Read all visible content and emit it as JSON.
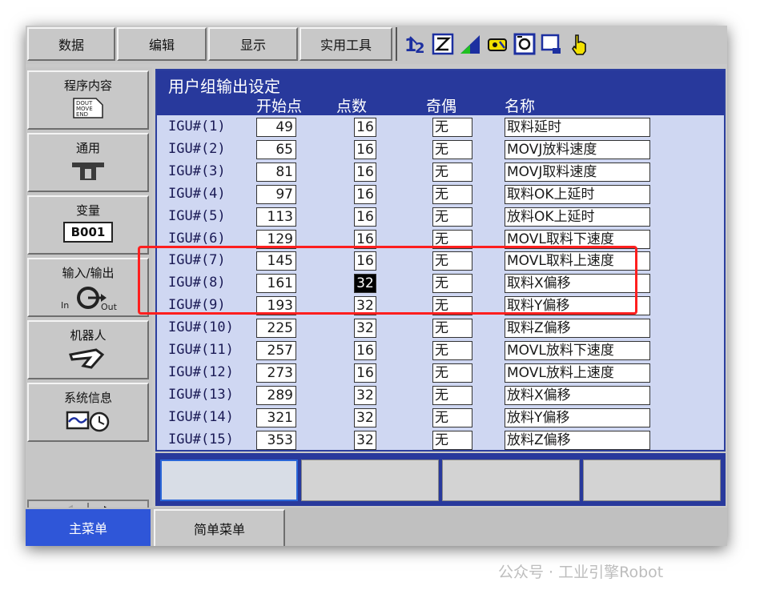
{
  "menu": [
    "数据",
    "编辑",
    "显示",
    "实用工具"
  ],
  "sidebar": [
    {
      "label": "程序内容",
      "icon": "program-content-icon",
      "icon_text": [
        "DOUT",
        "MOVE",
        "END"
      ]
    },
    {
      "label": "通用",
      "icon": "general-tool-icon"
    },
    {
      "label": "变量",
      "icon": "variable-icon",
      "badge": "B001"
    },
    {
      "label": "输入/输出",
      "icon": "io-icon",
      "sub_left": "In",
      "sub_right": "Out"
    },
    {
      "label": "机器人",
      "icon": "robot-arm-icon"
    },
    {
      "label": "系统信息",
      "icon": "system-info-icon"
    }
  ],
  "panel": {
    "title": "用户组输出设定",
    "columns": {
      "start": "开始点",
      "count": "点数",
      "parity": "奇偶",
      "name": "名称"
    }
  },
  "rows": [
    {
      "id": "IGU#(1)",
      "start": "49",
      "count": "16",
      "parity": "无",
      "name": "取料延时"
    },
    {
      "id": "IGU#(2)",
      "start": "65",
      "count": "16",
      "parity": "无",
      "name": "MOVJ放料速度"
    },
    {
      "id": "IGU#(3)",
      "start": "81",
      "count": "16",
      "parity": "无",
      "name": "MOVJ取料速度"
    },
    {
      "id": "IGU#(4)",
      "start": "97",
      "count": "16",
      "parity": "无",
      "name": "取料OK上延时"
    },
    {
      "id": "IGU#(5)",
      "start": "113",
      "count": "16",
      "parity": "无",
      "name": "放料OK上延时"
    },
    {
      "id": "IGU#(6)",
      "start": "129",
      "count": "16",
      "parity": "无",
      "name": "MOVL取料下速度"
    },
    {
      "id": "IGU#(7)",
      "start": "145",
      "count": "16",
      "parity": "无",
      "name": "MOVL取料上速度"
    },
    {
      "id": "IGU#(8)",
      "start": "161",
      "count": "32",
      "parity": "无",
      "name": "取料X偏移"
    },
    {
      "id": "IGU#(9)",
      "start": "193",
      "count": "32",
      "parity": "无",
      "name": "取料Y偏移"
    },
    {
      "id": "IGU#(10)",
      "start": "225",
      "count": "32",
      "parity": "无",
      "name": "取料Z偏移"
    },
    {
      "id": "IGU#(11)",
      "start": "257",
      "count": "16",
      "parity": "无",
      "name": "MOVL放料下速度"
    },
    {
      "id": "IGU#(12)",
      "start": "273",
      "count": "16",
      "parity": "无",
      "name": "MOVL放料上速度"
    },
    {
      "id": "IGU#(13)",
      "start": "289",
      "count": "32",
      "parity": "无",
      "name": "放料X偏移"
    },
    {
      "id": "IGU#(14)",
      "start": "321",
      "count": "32",
      "parity": "无",
      "name": "放料Y偏移"
    },
    {
      "id": "IGU#(15)",
      "start": "353",
      "count": "32",
      "parity": "无",
      "name": "放料Z偏移"
    }
  ],
  "selected_row": 7,
  "highlighted_rows": [
    7,
    8,
    9
  ],
  "bottom_tabs": {
    "main": "主菜单",
    "simple": "简单菜单"
  },
  "watermark": "公众号 · 工业引擎Robot",
  "colors": {
    "title_band": "#28399c",
    "panel_bg": "#cfd7f2",
    "highlight": "#ff1f1f",
    "main_tab": "#2f56d8"
  }
}
